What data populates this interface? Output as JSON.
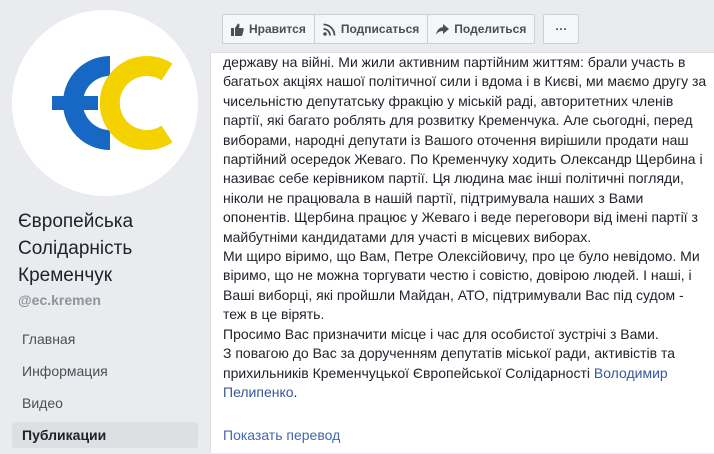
{
  "page": {
    "name_lines": [
      "Європейська",
      "Солідарність",
      "Кременчук"
    ],
    "handle": "@ec.kremen",
    "logo_text": "ЄС",
    "colors": {
      "logo_blue": "#1768c4",
      "logo_yellow": "#f4d200"
    }
  },
  "nav": [
    {
      "label": "Главная",
      "active": false
    },
    {
      "label": "Информация",
      "active": false
    },
    {
      "label": "Видео",
      "active": false
    },
    {
      "label": "Публикации",
      "active": true
    }
  ],
  "toolbar": {
    "like_label": "Нравится",
    "like_icon": "thumbs-up-icon",
    "subscribe_label": "Подписаться",
    "subscribe_icon": "rss-icon",
    "share_label": "Поделиться",
    "share_icon": "share-arrow-icon",
    "more_label": "···"
  },
  "post": {
    "paragraphs": [
      "державу на війні. Ми жили активним партійним життям: брали участь в багатьох акціях нашої політичної сили і вдома і в Києві, ми маємо другу за чисельністю депутатську фракцію у міській раді, авторитетних членів партії, які багато роблять для розвитку Кременчука. Але сьогодні, перед виборами, народні депутати із Вашого оточення вирішили продати наш партійний осередок Жеваго. По Кременчуку ходить Олександр Щербина і називає себе керівником партії. Ця людина має інші політичні погляди, ніколи не працювала в нашій партії, підтримувала наших з Вами опонентів. Щербина працює у Жеваго і веде переговори від імені партії з майбутніми кандидатами для участі в місцевих виборах.",
      "Ми щиро віримо, що Вам, Петре Олексійовичу, про це було невідомо. Ми віримо, що не можна торгувати честю і совістю, довірою людей. І наші, і Ваші виборці, які пройшли Майдан, АТО, підтримували Вас під судом - теж в це вірять.",
      "Просимо Вас призначити місце і час для особистої зустрічі з Вами."
    ],
    "closing": "З повагою до Вас за дорученням депутатів міської ради, активістів та прихильників Кременчуцької Європейської Солідарності",
    "author": "Володимир Пелипенко",
    "author_suffix": ".",
    "translate_label": "Показать перевод"
  }
}
